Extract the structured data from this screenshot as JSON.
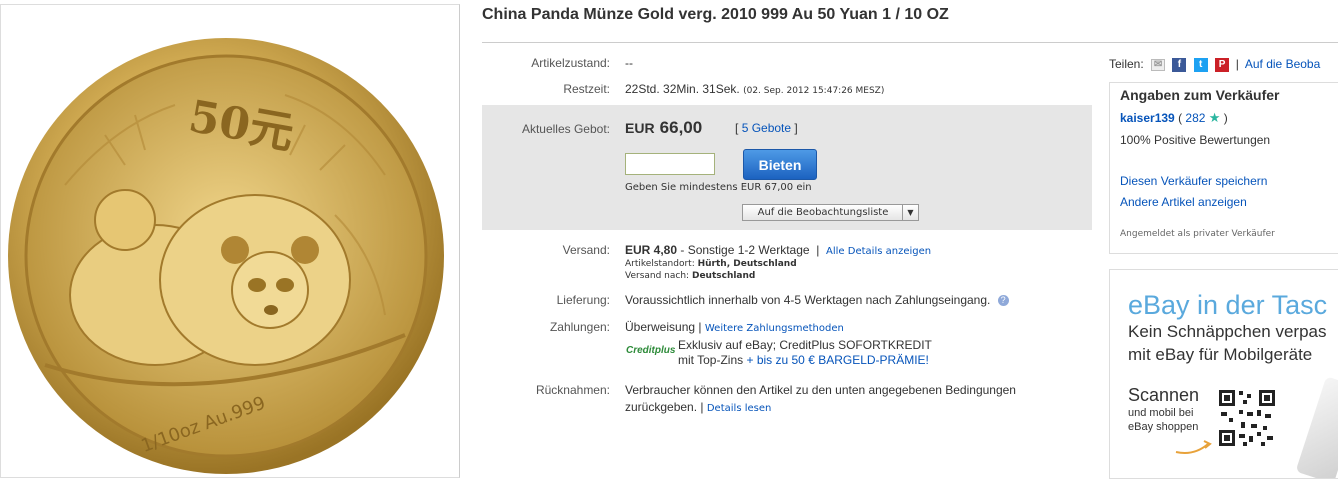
{
  "listing": {
    "title": "China Panda Münze Gold verg. 2010 999 Au 50 Yuan 1 / 10 OZ",
    "coin_face_value": "50元",
    "coin_rim_text": "1/10oz Au.999"
  },
  "details": {
    "condition_label": "Artikelzustand:",
    "condition_value": "--",
    "time_label": "Restzeit:",
    "time_value": "22Std. 32Min. 31Sek.",
    "time_end": "(02. Sep. 2012 15:47:26 MESZ)"
  },
  "bid": {
    "label": "Aktuelles Gebot:",
    "currency": "EUR",
    "amount": "66,00",
    "bids_open": "[",
    "bids_link": "5 Gebote",
    "bids_close": "]",
    "input_value": "",
    "button_label": "Bieten",
    "min_bid_hint": "Geben Sie mindestens EUR 67,00 ein",
    "watch_label": "Auf die Beobachtungsliste"
  },
  "shipping": {
    "label": "Versand:",
    "price": "EUR 4,80",
    "method": "- Sonstige 1-2 Werktage",
    "separator": "|",
    "details_link": "Alle Details anzeigen",
    "location_label": "Artikelstandort:",
    "location_value": "Hürth, Deutschland",
    "ship_to_label": "Versand nach:",
    "ship_to_value": "Deutschland"
  },
  "delivery": {
    "label": "Lieferung:",
    "value": "Voraussichtlich innerhalb von 4-5 Werktagen nach Zahlungseingang."
  },
  "payment": {
    "label": "Zahlungen:",
    "method": "Überweisung",
    "separator": "|",
    "more_link": "Weitere Zahlungsmethoden",
    "creditplus_logo": "Creditplus",
    "creditplus_line1": "Exklusiv auf eBay; CreditPlus SOFORTKREDIT",
    "creditplus_line2a": "mit Top-Zins",
    "creditplus_line2b": "+ bis zu 50 € BARGELD-PRÄMIE!"
  },
  "returns": {
    "label": "Rücknahmen:",
    "line1": "Verbraucher können den Artikel zu den unten angegebenen Bedingungen",
    "line2": "zurückgeben.",
    "separator": "|",
    "details_link": "Details lesen"
  },
  "share": {
    "label": "Teilen:",
    "separator": "|",
    "watch_link": "Auf die Beoba"
  },
  "seller": {
    "heading": "Angaben zum Verkäufer",
    "name": "kaiser139",
    "rating_open": "(",
    "rating": "282",
    "rating_close": ")",
    "positive": "100% Positive Bewertungen",
    "save_link": "Diesen Verkäufer speichern",
    "other_link": "Andere Artikel anzeigen",
    "type": "Angemeldet als privater Verkäufer"
  },
  "ad": {
    "headline": "eBay in der Tasc",
    "line1": "Kein Schnäppchen verpas",
    "line2": "mit eBay für Mobilgeräte",
    "scan": "Scannen",
    "scan_sub1": "und mobil bei",
    "scan_sub2": "eBay shoppen"
  },
  "colors": {
    "link": "#0654ba",
    "bid_box": "#e6e6e6",
    "button_blue": "#1c62c0",
    "gold": "#c9a54b",
    "ad_blue": "#5aa9dd"
  }
}
